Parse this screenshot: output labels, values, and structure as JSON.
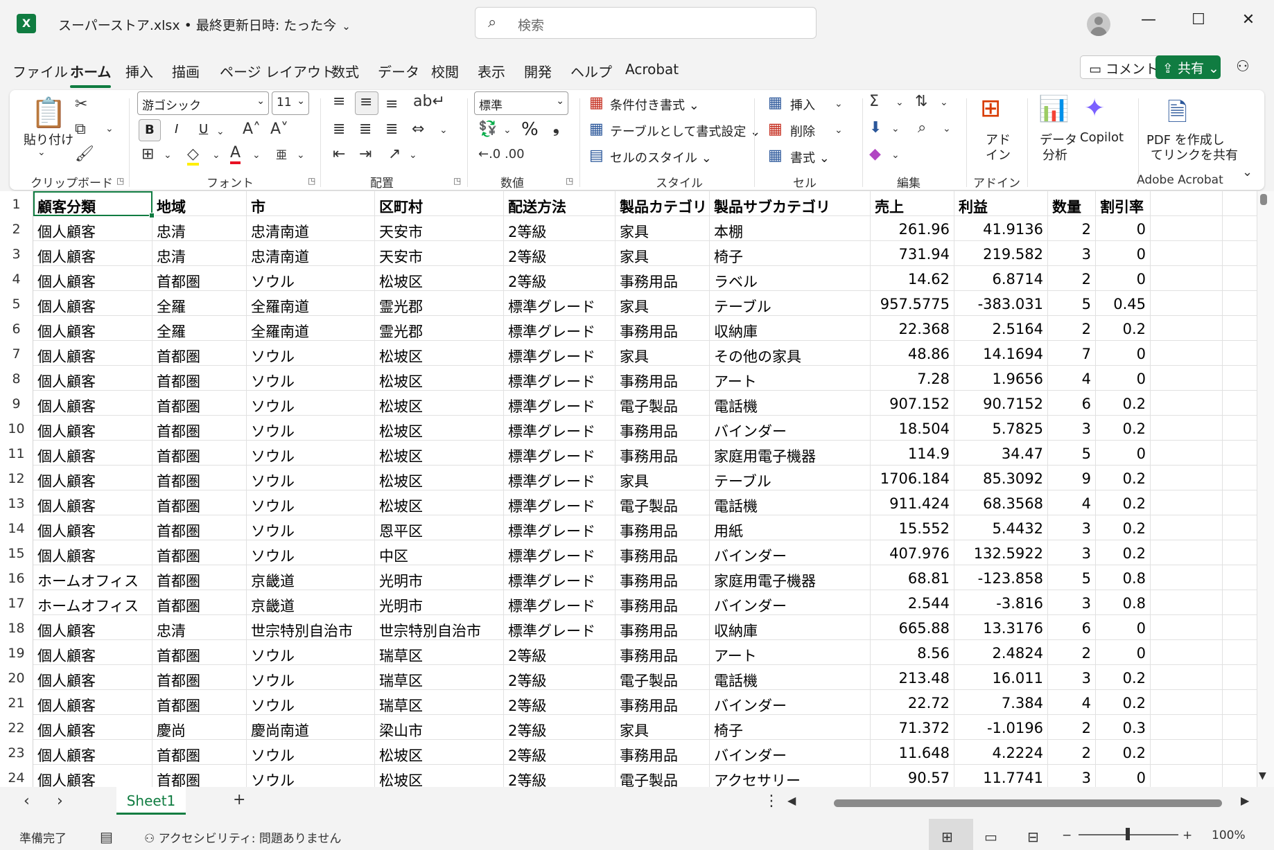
{
  "window": {
    "title": "スーパーストア.xlsx • 最終更新日時: たった今",
    "search_placeholder": "検索"
  },
  "menu": {
    "tabs": [
      "ファイル",
      "ホーム",
      "挿入",
      "描画",
      "ページ レイアウト",
      "数式",
      "データ",
      "校閲",
      "表示",
      "開発",
      "ヘルプ",
      "Acrobat"
    ],
    "comment_label": "コメント",
    "share_label": "共有"
  },
  "ribbon": {
    "clipboard": {
      "paste_label": "貼り付け",
      "group_label": "クリップボード"
    },
    "font": {
      "name": "游ゴシック",
      "size": "11",
      "group_label": "フォント",
      "bold": "B",
      "italic": "I",
      "underline": "U"
    },
    "alignment": {
      "group_label": "配置"
    },
    "number": {
      "format": "標準",
      "group_label": "数値",
      "percent": "%"
    },
    "styles": {
      "conditional": "条件付き書式",
      "as_table": "テーブルとして書式設定",
      "cell_styles": "セルのスタイル",
      "group_label": "スタイル"
    },
    "cells": {
      "insert": "挿入",
      "delete": "削除",
      "format": "書式",
      "group_label": "セル"
    },
    "editing": {
      "group_label": "編集"
    },
    "addins": {
      "label1": "アド",
      "label2": "イン",
      "group_label": "アドイン"
    },
    "analyze": {
      "label1": "データ",
      "label2": "分析"
    },
    "copilot": {
      "label": "Copilot"
    },
    "acrobat": {
      "label1": "PDF を作成し",
      "label2": "てリンクを共有",
      "group_label": "Adobe Acrobat"
    }
  },
  "grid": {
    "headers": [
      "顧客分類",
      "地域",
      "市",
      "区町村",
      "配送方法",
      "製品カテゴリ",
      "製品サブカテゴリ",
      "売上",
      "利益",
      "数量",
      "割引率"
    ],
    "rows": [
      [
        "個人顧客",
        "忠清",
        "忠清南道",
        "天安市",
        "2等級",
        "家具",
        "本棚",
        "261.96",
        "41.9136",
        "2",
        "0"
      ],
      [
        "個人顧客",
        "忠清",
        "忠清南道",
        "天安市",
        "2等級",
        "家具",
        "椅子",
        "731.94",
        "219.582",
        "3",
        "0"
      ],
      [
        "個人顧客",
        "首都圏",
        "ソウル",
        "松坡区",
        "2等級",
        "事務用品",
        "ラベル",
        "14.62",
        "6.8714",
        "2",
        "0"
      ],
      [
        "個人顧客",
        "全羅",
        "全羅南道",
        "霊光郡",
        "標準グレード",
        "家具",
        "テーブル",
        "957.5775",
        "-383.031",
        "5",
        "0.45"
      ],
      [
        "個人顧客",
        "全羅",
        "全羅南道",
        "霊光郡",
        "標準グレード",
        "事務用品",
        "収納庫",
        "22.368",
        "2.5164",
        "2",
        "0.2"
      ],
      [
        "個人顧客",
        "首都圏",
        "ソウル",
        "松坡区",
        "標準グレード",
        "家具",
        "その他の家具",
        "48.86",
        "14.1694",
        "7",
        "0"
      ],
      [
        "個人顧客",
        "首都圏",
        "ソウル",
        "松坡区",
        "標準グレード",
        "事務用品",
        "アート",
        "7.28",
        "1.9656",
        "4",
        "0"
      ],
      [
        "個人顧客",
        "首都圏",
        "ソウル",
        "松坡区",
        "標準グレード",
        "電子製品",
        "電話機",
        "907.152",
        "90.7152",
        "6",
        "0.2"
      ],
      [
        "個人顧客",
        "首都圏",
        "ソウル",
        "松坡区",
        "標準グレード",
        "事務用品",
        "バインダー",
        "18.504",
        "5.7825",
        "3",
        "0.2"
      ],
      [
        "個人顧客",
        "首都圏",
        "ソウル",
        "松坡区",
        "標準グレード",
        "事務用品",
        "家庭用電子機器",
        "114.9",
        "34.47",
        "5",
        "0"
      ],
      [
        "個人顧客",
        "首都圏",
        "ソウル",
        "松坡区",
        "標準グレード",
        "家具",
        "テーブル",
        "1706.184",
        "85.3092",
        "9",
        "0.2"
      ],
      [
        "個人顧客",
        "首都圏",
        "ソウル",
        "松坡区",
        "標準グレード",
        "電子製品",
        "電話機",
        "911.424",
        "68.3568",
        "4",
        "0.2"
      ],
      [
        "個人顧客",
        "首都圏",
        "ソウル",
        "恩平区",
        "標準グレード",
        "事務用品",
        "用紙",
        "15.552",
        "5.4432",
        "3",
        "0.2"
      ],
      [
        "個人顧客",
        "首都圏",
        "ソウル",
        "中区",
        "標準グレード",
        "事務用品",
        "バインダー",
        "407.976",
        "132.5922",
        "3",
        "0.2"
      ],
      [
        "ホームオフィス",
        "首都圏",
        "京畿道",
        "光明市",
        "標準グレード",
        "事務用品",
        "家庭用電子機器",
        "68.81",
        "-123.858",
        "5",
        "0.8"
      ],
      [
        "ホームオフィス",
        "首都圏",
        "京畿道",
        "光明市",
        "標準グレード",
        "事務用品",
        "バインダー",
        "2.544",
        "-3.816",
        "3",
        "0.8"
      ],
      [
        "個人顧客",
        "忠清",
        "世宗特別自治市",
        "世宗特別自治市",
        "標準グレード",
        "事務用品",
        "収納庫",
        "665.88",
        "13.3176",
        "6",
        "0"
      ],
      [
        "個人顧客",
        "首都圏",
        "ソウル",
        "瑞草区",
        "2等級",
        "事務用品",
        "アート",
        "8.56",
        "2.4824",
        "2",
        "0"
      ],
      [
        "個人顧客",
        "首都圏",
        "ソウル",
        "瑞草区",
        "2等級",
        "電子製品",
        "電話機",
        "213.48",
        "16.011",
        "3",
        "0.2"
      ],
      [
        "個人顧客",
        "首都圏",
        "ソウル",
        "瑞草区",
        "2等級",
        "事務用品",
        "バインダー",
        "22.72",
        "7.384",
        "4",
        "0.2"
      ],
      [
        "個人顧客",
        "慶尚",
        "慶尚南道",
        "梁山市",
        "2等級",
        "家具",
        "椅子",
        "71.372",
        "-1.0196",
        "2",
        "0.3"
      ],
      [
        "個人顧客",
        "首都圏",
        "ソウル",
        "松坡区",
        "2等級",
        "事務用品",
        "バインダー",
        "11.648",
        "4.2224",
        "2",
        "0.2"
      ],
      [
        "個人顧客",
        "首都圏",
        "ソウル",
        "松坡区",
        "2等級",
        "電子製品",
        "アクセサリー",
        "90.57",
        "11.7741",
        "3",
        "0"
      ]
    ]
  },
  "sheets": {
    "active": "Sheet1",
    "add": "+"
  },
  "status": {
    "ready": "準備完了",
    "accessibility": "アクセシビリティ: 問題ありません",
    "zoom": "100%"
  }
}
